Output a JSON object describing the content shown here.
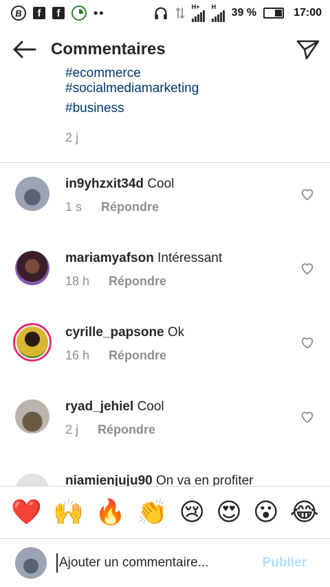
{
  "status_bar": {
    "battery_percent": "39 %",
    "time": "17:00",
    "net1": "H+",
    "net2": "H",
    "left_icons": [
      "b-app-icon",
      "facebook-icon",
      "facebook-icon",
      "clock-app-icon",
      "more-dots-icon"
    ],
    "right_icons": [
      "headphones-icon",
      "data-transfer-icon",
      "signal-icon",
      "signal-icon",
      "battery-icon"
    ]
  },
  "header": {
    "title": "Commentaires",
    "back_icon": "arrow-left-icon",
    "send_icon": "paper-plane-icon"
  },
  "caption": {
    "hashtags": [
      "#ecommerce",
      "#socialmediamarketing",
      "#business"
    ],
    "time": "2 j"
  },
  "comments": [
    {
      "username": "in9yhzxit34d",
      "text": "Cool",
      "time": "1 s",
      "reply_label": "Répondre",
      "avatar_color": "#8c94a8",
      "story_ring": false
    },
    {
      "username": "mariamyafson",
      "text": "Intéressant",
      "time": "18 h",
      "reply_label": "Répondre",
      "avatar_color": "#5a2a3a",
      "story_ring": false
    },
    {
      "username": "cyrille_papsone",
      "text": "Ok",
      "time": "16 h",
      "reply_label": "Répondre",
      "avatar_color": "#d8b632",
      "story_ring": true
    },
    {
      "username": "ryad_jehiel",
      "text": "Cool",
      "time": "2 j",
      "reply_label": "Répondre",
      "avatar_color": "#6d5a42",
      "story_ring": false
    },
    {
      "username": "niamienjuju90",
      "text": "On va en profiter",
      "time": "",
      "reply_label": "",
      "avatar_color": "#c9c9c9",
      "story_ring": false
    }
  ],
  "emoji_bar": [
    {
      "name": "red-heart-emoji",
      "char": "❤️"
    },
    {
      "name": "raising-hands-emoji",
      "char": "🙌"
    },
    {
      "name": "fire-emoji",
      "char": "🔥"
    },
    {
      "name": "clapping-hands-emoji",
      "char": "👏"
    },
    {
      "name": "crying-face-emoji",
      "char": "😢"
    },
    {
      "name": "heart-eyes-emoji",
      "char": "😍"
    },
    {
      "name": "astonished-face-emoji",
      "char": "😮"
    },
    {
      "name": "tears-of-joy-emoji",
      "char": "😂"
    }
  ],
  "input": {
    "placeholder": "Ajouter un commentaire...",
    "publish_label": "Publier"
  },
  "colors": {
    "hashtag": "#00376b",
    "muted": "#8e8e8e",
    "publish_disabled": "#b2dffc",
    "story_ring": "#e1306c"
  }
}
